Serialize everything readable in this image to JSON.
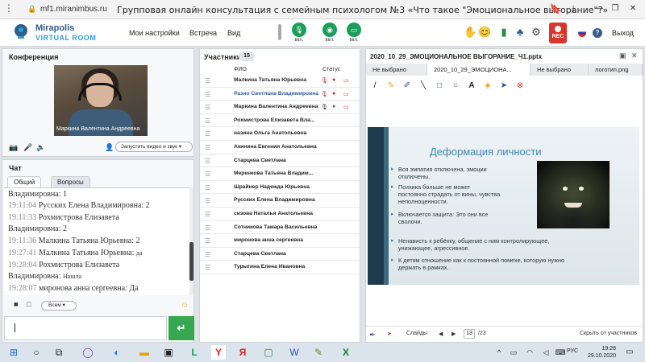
{
  "browser": {
    "url": "mf1.miranimbus.ru",
    "title": "Групповая онлайн консультация с семейным психологом №3 «Что такое \"Эмоциональное выгорание\"?»"
  },
  "header": {
    "logo_line1": "Mirapolis",
    "logo_line2": "VIRTUAL ROOM",
    "nav": [
      "Мои настройки",
      "Встреча",
      "Вид"
    ],
    "mic_label": "вкл.",
    "cam_label": "вкл.",
    "screen_label": "вкл.",
    "rec_label": "REC",
    "exit_label": "Выход"
  },
  "conference": {
    "title": "Конференция",
    "video_name": "Маркина Валентина Андреевна",
    "start_video_label": "Запустить видео и звук"
  },
  "chat": {
    "title": "Чат",
    "tabs": [
      "Общий",
      "Вопросы"
    ],
    "messages": [
      {
        "time": "",
        "who": "Владимировна:",
        "text": "1"
      },
      {
        "time": "19:11:04",
        "who": "Русских Елена Владимировна:",
        "text": "2"
      },
      {
        "time": "19:11:33",
        "who": "Рохмистрова  Елизавета",
        "text": ""
      },
      {
        "time": "",
        "who": "Владимировна:",
        "text": "2"
      },
      {
        "time": "19:11:36",
        "who": "Малкина Татьяна  Юрьевна:",
        "text": "2"
      },
      {
        "time": "19:27:41",
        "who": "Малкина Татьяна  Юрьевна:",
        "text": "да"
      },
      {
        "time": "19:28:04",
        "who": "Рохмистрова  Елизавета",
        "text": ""
      },
      {
        "time": "",
        "who": "Владимировна:",
        "text": "Нашла"
      },
      {
        "time": "19:28:07",
        "who": "миронова  анна  сергеевна:",
        "text": "Да"
      }
    ],
    "recipient": "Всем",
    "input_value": ""
  },
  "participants": {
    "title": "Участники",
    "count": "15",
    "col_name": "ФИО",
    "col_status": "Статус",
    "rows": [
      "Малкина Татьяна  Юрьевна",
      "Разно Светлана  Владимировна",
      "Маркина Валентина  Андреевна",
      "Рохмистрова  Елизавета Вла...",
      "назина  Ольга  Анатольевна",
      "Акинина  Евгения  Анатольевна",
      "Старцева  Светлана",
      "Меренкова  Татьяна  Владим...",
      "Шрайнер Надежда  Юрьевна",
      "Русских Елена Владимировна",
      "сизова  Наталья  Анатольевна",
      "Сотникова  Тамара Васильевна",
      "миронова  анна  сергеевна",
      "Старцева Светлана",
      "Турыгина  Елена  Ивановна"
    ]
  },
  "presentation": {
    "file_title": "2020_10_29_ЭМОЦИОНАЛЬНОЕ ВЫГОРАНИЕ_Ч1.pptx",
    "tabs": [
      "Не выбрано",
      "2020_10_29_ЭМОЦИОНА...",
      "Не выбрано",
      "логотип.png"
    ],
    "slide_heading": "Деформация личности",
    "bullets": [
      [
        "Вся эмпатия отключена, эмоции",
        "отключены."
      ],
      [
        "Психика больше не может",
        "постоянно страдать от вины, чувства",
        "неполноценности."
      ],
      [
        "Включается защита: Это они все",
        "сволочи."
      ],
      [
        "Ненависть к ребёнку, общение с ним контролирующее,",
        "унижающее, агрессивное."
      ],
      [
        "К детям отношение как к постоянной помехе, которую нужно",
        "держать в рамках."
      ]
    ],
    "slides_label": "Слайды",
    "current_page": "13",
    "total_pages": "/23",
    "hide_label": "Скрыть от участников"
  },
  "taskbar": {
    "lang": "РУС",
    "time": "19:28",
    "date": "29.10.2020"
  },
  "colors": {
    "accent_green": "#1a9e5a",
    "rec_red": "#d9352a",
    "slide_heading": "#3d8ab0"
  }
}
